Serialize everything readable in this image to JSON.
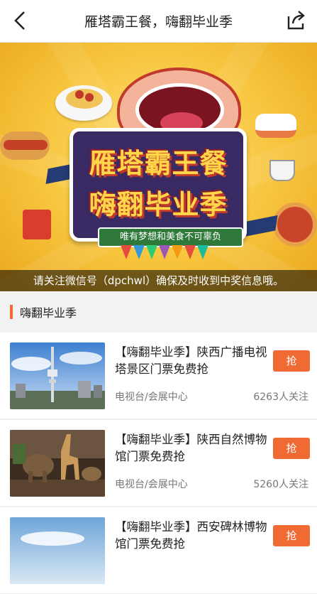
{
  "header": {
    "title": "雁塔霸王餐，嗨翻毕业季"
  },
  "banner": {
    "line1": "雁塔霸王餐",
    "line2": "嗨翻毕业季",
    "ribbon": "唯有梦想和美食不可辜负",
    "notice": "请关注微信号（dpchwl）确保及时收到中奖信息哦。"
  },
  "section": {
    "title": "嗨翻毕业季"
  },
  "items": [
    {
      "title": "【嗨翻毕业季】陕西广播电视塔景区门票免费抢",
      "category": "电视台/会展中心",
      "count": "6263人关注",
      "button": "抢"
    },
    {
      "title": "【嗨翻毕业季】陕西自然博物馆门票免费抢",
      "category": "电视台/会展中心",
      "count": "5260人关注",
      "button": "抢"
    },
    {
      "title": "【嗨翻毕业季】西安碑林博物馆门票免费抢",
      "category": "",
      "count": "",
      "button": "抢"
    }
  ],
  "colors": {
    "accent": "#f06b33",
    "banner": "#f7c43c"
  }
}
